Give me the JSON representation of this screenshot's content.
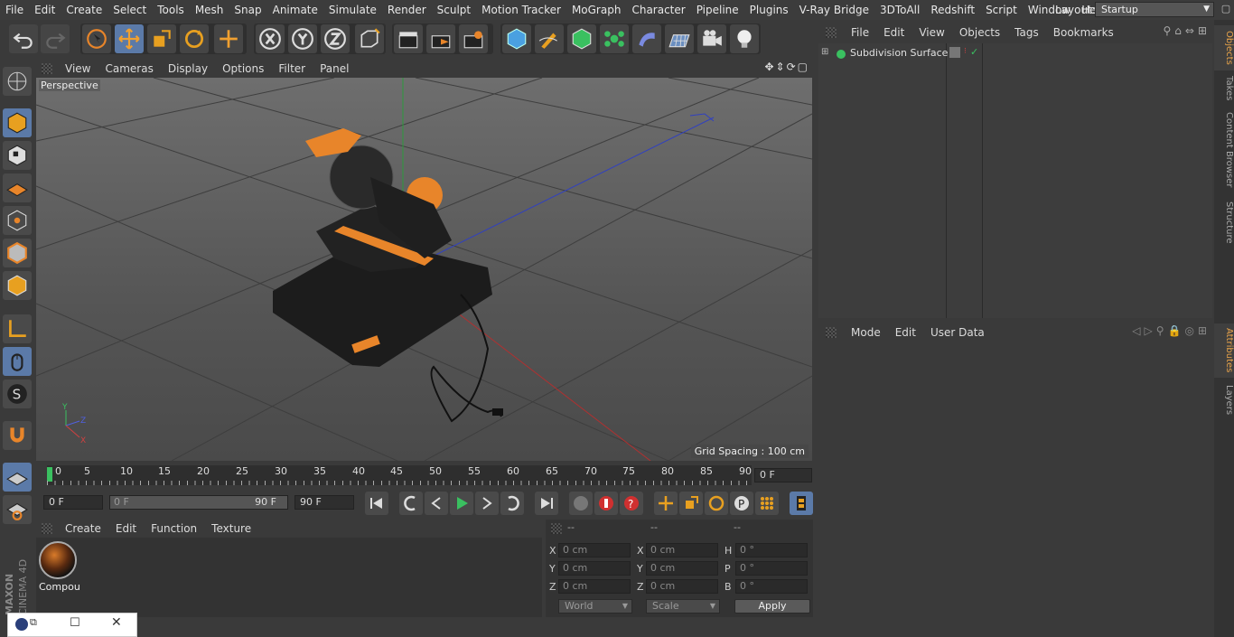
{
  "menubar": {
    "items": [
      "File",
      "Edit",
      "Create",
      "Select",
      "Tools",
      "Mesh",
      "Snap",
      "Animate",
      "Simulate",
      "Render",
      "Sculpt",
      "Motion Tracker",
      "MoGraph",
      "Character",
      "Pipeline",
      "Plugins",
      "V-Ray Bridge",
      "3DToAll",
      "Redshift",
      "Script",
      "Window",
      "Help"
    ],
    "layout_label": "Layout:",
    "layout_value": "Startup"
  },
  "viewport": {
    "menu": [
      "View",
      "Cameras",
      "Display",
      "Options",
      "Filter",
      "Panel"
    ],
    "title": "Perspective",
    "grid_spacing": "Grid Spacing : 100 cm"
  },
  "timeline": {
    "ticks": [
      "0",
      "5",
      "10",
      "15",
      "20",
      "25",
      "30",
      "35",
      "40",
      "45",
      "50",
      "55",
      "60",
      "65",
      "70",
      "75",
      "80",
      "85",
      "90"
    ],
    "current_frame": "0 F"
  },
  "playback": {
    "start": "0 F",
    "range_start": "0 F",
    "range_end": "90 F",
    "end": "90 F"
  },
  "material": {
    "menu": [
      "Create",
      "Edit",
      "Function",
      "Texture"
    ],
    "name": "Compou"
  },
  "coordinates": {
    "headers": [
      "--",
      "--",
      "--"
    ],
    "rows": [
      {
        "l1": "X",
        "v1": "0 cm",
        "l2": "X",
        "v2": "0 cm",
        "l3": "H",
        "v3": "0 °"
      },
      {
        "l1": "Y",
        "v1": "0 cm",
        "l2": "Y",
        "v2": "0 cm",
        "l3": "P",
        "v3": "0 °"
      },
      {
        "l1": "Z",
        "v1": "0 cm",
        "l2": "Z",
        "v2": "0 cm",
        "l3": "B",
        "v3": "0 °"
      }
    ],
    "world": "World",
    "scale": "Scale",
    "apply": "Apply"
  },
  "objects": {
    "menu": [
      "File",
      "Edit",
      "View",
      "Objects",
      "Tags",
      "Bookmarks"
    ],
    "items": [
      {
        "name": "Subdivision Surface"
      }
    ]
  },
  "attributes": {
    "menu": [
      "Mode",
      "Edit",
      "User Data"
    ]
  },
  "side_tabs": [
    "Objects",
    "Takes",
    "Content Browser",
    "Structure",
    "Attributes",
    "Layers"
  ],
  "logo": {
    "line1": "MAXON",
    "line2": "CINEMA 4D"
  },
  "colors": {
    "accent": "#5b7aa8",
    "orange": "#e8852a",
    "tab_active": "#e8a34a"
  }
}
